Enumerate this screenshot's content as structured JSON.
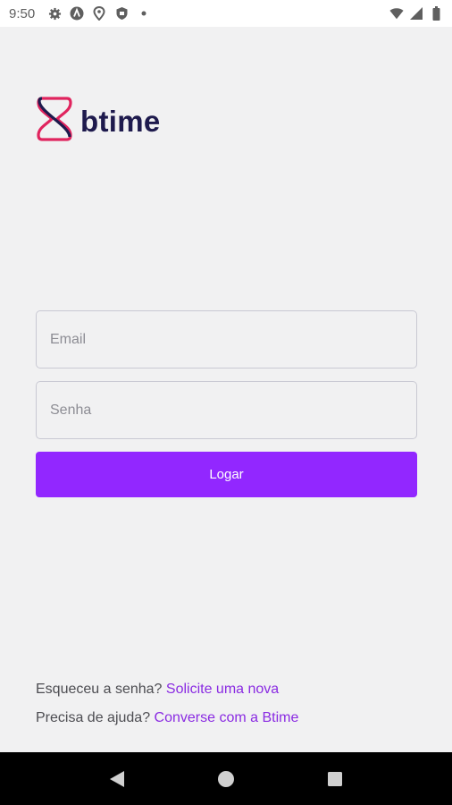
{
  "status_bar": {
    "time": "9:50",
    "left_icons": [
      "gear-icon",
      "app-a-icon",
      "location-icon",
      "shield-icon",
      "dot-icon"
    ],
    "right_icons": [
      "wifi-icon",
      "signal-icon",
      "battery-icon"
    ]
  },
  "brand": {
    "name": "btime",
    "accent_color": "#9227ff",
    "logo_color_primary": "#e0245e",
    "logo_color_secondary": "#1e1a4d"
  },
  "form": {
    "email_placeholder": "Email",
    "password_placeholder": "Senha",
    "login_label": "Logar"
  },
  "help": {
    "forgot_prefix": "Esqueceu a senha? ",
    "forgot_link": "Solicite uma nova",
    "support_prefix": "Precisa de ajuda? ",
    "support_link": "Converse com a Btime"
  },
  "nav": {
    "back": "back-icon",
    "home": "home-icon",
    "recents": "recents-icon"
  }
}
